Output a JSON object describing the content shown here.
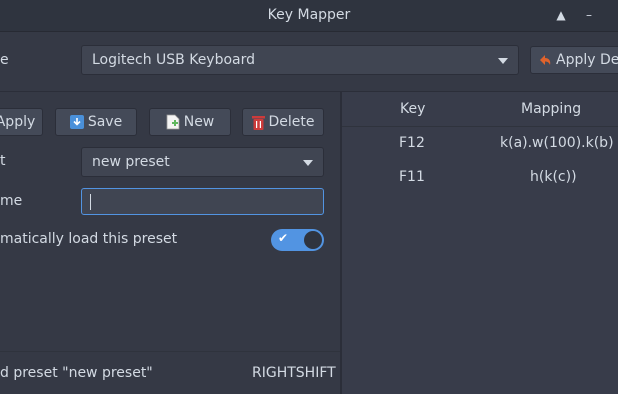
{
  "window": {
    "title": "Key Mapper",
    "controls": {
      "minimize": "▲",
      "close": "–"
    }
  },
  "top": {
    "device_label": "e",
    "device_selected": "Logitech USB Keyboard",
    "apply_defaults": "Apply Def"
  },
  "toolbar": {
    "apply": "Apply",
    "save": "Save",
    "new": "New",
    "delete": "Delete"
  },
  "form": {
    "preset_label": "t",
    "preset_selected": "new preset",
    "name_label": "me",
    "name_value": "",
    "autoload_label": "matically load this preset",
    "autoload_on": true,
    "autoload_check": "✔"
  },
  "table": {
    "headers": [
      "Key",
      "Mapping"
    ],
    "rows": [
      {
        "key": "F12",
        "mapping": "k(a).w(100).k(b)"
      },
      {
        "key": "F11",
        "mapping": "h(k(c))"
      }
    ]
  },
  "status": {
    "message": "d preset \"new preset\"",
    "key": "RIGHTSHIFT"
  },
  "colors": {
    "accent": "#5294e2",
    "background": "#353945",
    "delete_icon": "#cc3b3b",
    "save_icon": "#4a90d9",
    "apply_default_icon": "#e0632c",
    "new_icon": "#5fb85f"
  }
}
